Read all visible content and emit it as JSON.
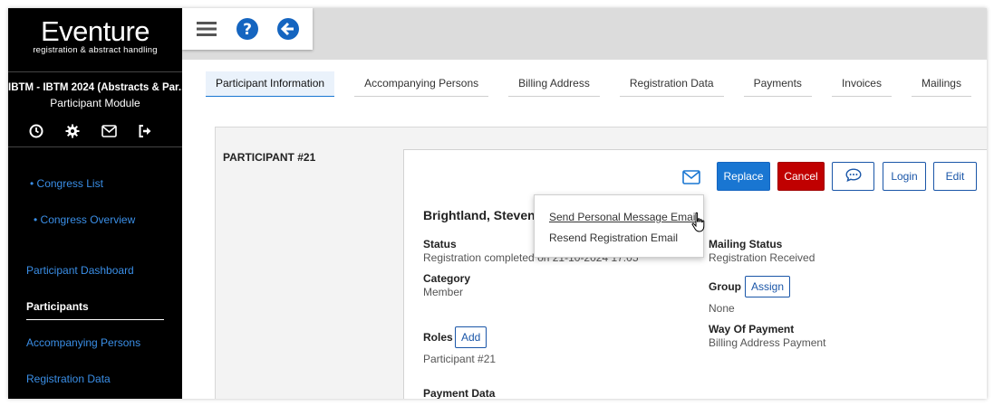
{
  "sidebar": {
    "logo_title": "Eventure",
    "logo_subtitle": "registration & abstract handling",
    "event_name": "IBTM - IBTM 2024 (Abstracts & Par...",
    "module_name": "Participant Module",
    "icons": [
      "clock-icon",
      "gear-icon",
      "envelope-icon",
      "logout-icon"
    ],
    "links": {
      "congress_list": "• Congress List",
      "congress_overview": "• Congress Overview",
      "participant_dashboard": "Participant Dashboard",
      "participants": "Participants",
      "accompanying_persons": "Accompanying Persons",
      "registration_data": "Registration Data"
    }
  },
  "toolbar": {
    "icons": [
      "hamburger-menu-icon",
      "help-icon",
      "back-arrow-icon"
    ]
  },
  "tabs": [
    {
      "label": "Participant Information"
    },
    {
      "label": "Accompanying Persons"
    },
    {
      "label": "Billing Address"
    },
    {
      "label": "Registration Data"
    },
    {
      "label": "Payments"
    },
    {
      "label": "Invoices"
    },
    {
      "label": "Mailings"
    }
  ],
  "participant": {
    "panel_label": "PARTICIPANT #21",
    "name": "Brightland, Steven",
    "status_label": "Status",
    "status_value": "Registration completed on 21-10-2024 17:05",
    "category_label": "Category",
    "category_value": "Member",
    "roles_label": "Roles",
    "roles_value": "Participant #21",
    "payment_data_label": "Payment Data",
    "mailing_status_label": "Mailing Status",
    "mailing_status_value": "Registration Received",
    "group_label": "Group",
    "group_value": "None",
    "way_of_payment_label": "Way Of Payment",
    "way_of_payment_value": "Billing Address Payment"
  },
  "actions": {
    "replace": "Replace",
    "cancel": "Cancel",
    "login": "Login",
    "edit": "Edit",
    "assign": "Assign",
    "add": "Add"
  },
  "mail_menu": {
    "items": [
      "Send Personal Message Email",
      "Resend Registration Email"
    ]
  },
  "colors": {
    "primary": "#1976d2",
    "danger": "#c00000",
    "sidebar_bg": "#000000",
    "link": "#3a8ee6"
  }
}
